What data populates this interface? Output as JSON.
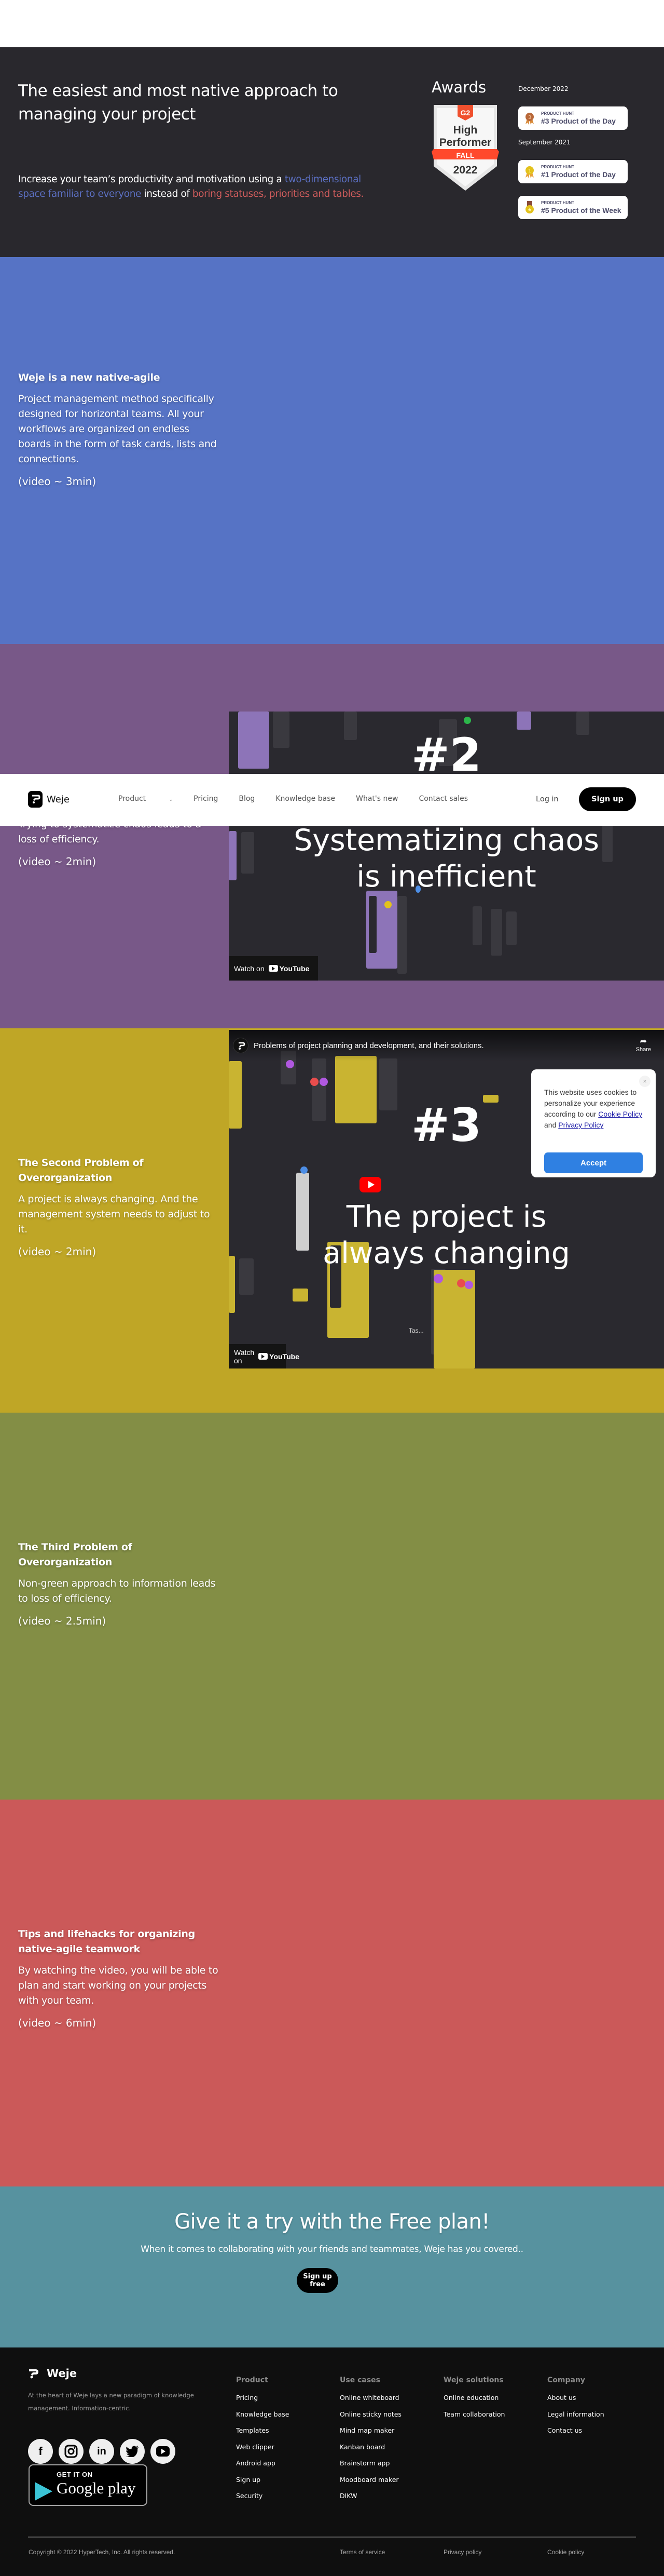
{
  "hero": {
    "title": "The easiest and most native approach to managing your project",
    "sub_plain_1": "Increase your team’s productivity and motivation using a ",
    "sub_blue": "two-dimensional space familiar to everyone",
    "sub_plain_2": " instead of ",
    "sub_red": "boring statuses, priorities and tables.",
    "awards_title": "Awards",
    "g2": {
      "brand": "G2",
      "line1": "High",
      "line2": "Performer",
      "season": "FALL",
      "year": "2022"
    },
    "award_groups": [
      {
        "date": "December 2022",
        "cards": [
          {
            "source": "PRODUCT HUNT",
            "title": "#3 Product of the Day",
            "medal": "bronze-3"
          }
        ]
      },
      {
        "date": "September 2021",
        "cards": [
          {
            "source": "PRODUCT HUNT",
            "title": "#1 Product of the Day",
            "medal": "gold-1"
          },
          {
            "source": "PRODUCT HUNT",
            "title": "#5 Product of the Week",
            "medal": "gold-star"
          }
        ]
      }
    ]
  },
  "nav": {
    "brand": "Weje",
    "links": [
      "Product",
      "Pricing",
      "Blog",
      "Knowledge base",
      "What's new",
      "Contact sales"
    ],
    "login": "Log in",
    "signup": "Sign up"
  },
  "sections": [
    {
      "color": "#5673c5",
      "heading": "Weje is a new native-agile",
      "body": "Project management method specifically designed for horizontal teams. All your workflows are organized on endless boards in the form of task cards, lists and connections.",
      "duration": "(video ~ 3min)"
    },
    {
      "color": "#785888",
      "heading": "",
      "body": "Trying to systematize chaos leads to a loss of efficiency.",
      "duration": "(video ~ 2min)",
      "video": {
        "number": "#2",
        "caption_line1": "Systematizing chaos",
        "caption_line2": "is inefficient",
        "watch_on": "Watch on",
        "yt": "YouTube"
      }
    },
    {
      "color": "#bfa626",
      "heading": "The Second Problem of Overorganization",
      "body": "A project is always changing. And the management system needs to adjust to it.",
      "duration": "(video ~ 2min)",
      "video": {
        "title": "Problems of project planning and development, and their solutions.",
        "share": "Share",
        "number": "#3",
        "caption_line1": "The project is",
        "caption_line2": "always changing",
        "watch_on": "Watch on",
        "yt": "YouTube",
        "card_label": "Tas..."
      }
    },
    {
      "color": "#838e45",
      "heading": "The Third Problem of Overorganization",
      "body": "Non-green approach to information leads to loss of efficiency.",
      "duration": "(video ~ 2.5min)"
    },
    {
      "color": "#cb5959",
      "heading": "Tips and lifehacks for organizing native-agile teamwork",
      "body": "By watching the video, you will be able to plan and start working on your projects with your team.",
      "duration": "(video ~ 6min)"
    }
  ],
  "cookie": {
    "text_1": "This website uses cookies to personalize your experience according to our ",
    "cookie_link": "Cookie Policy",
    "text_2": " and ",
    "privacy_link": "Privacy Policy",
    "accept": "Accept",
    "close": "×"
  },
  "cta": {
    "title": "Give it a try with the Free plan!",
    "subtitle": "When it comes to collaborating with your friends and teammates, Weje has you covered..",
    "button": "Sign up free"
  },
  "footer": {
    "brand": "Weje",
    "description": "At the heart of Weje lays a new paradigm of knowledge management. Information-centric.",
    "social": [
      "facebook",
      "instagram",
      "linkedin",
      "twitter",
      "youtube"
    ],
    "gplay_top": "GET IT ON",
    "gplay_main": "Google play",
    "columns": [
      {
        "title": "Product",
        "items": [
          "Pricing",
          "Knowledge base",
          "Templates",
          "Web clipper",
          "Android app",
          "Sign up",
          "Security"
        ]
      },
      {
        "title": "Use cases",
        "items": [
          "Online whiteboard",
          "Online sticky notes",
          "Mind map maker",
          "Kanban board",
          "Brainstorm app",
          "Moodboard maker",
          "DIKW"
        ]
      },
      {
        "title": "Weje solutions",
        "items": [
          "Online education",
          "Team collaboration"
        ]
      },
      {
        "title": "Company",
        "items": [
          "About us",
          "Legal information",
          "Contact us"
        ]
      }
    ],
    "copyright": "Copyright © 2022 HyperTech, Inc. All rights reserved.",
    "legal": [
      "Terms of service",
      "Privacy policy",
      "Cookie policy"
    ]
  }
}
